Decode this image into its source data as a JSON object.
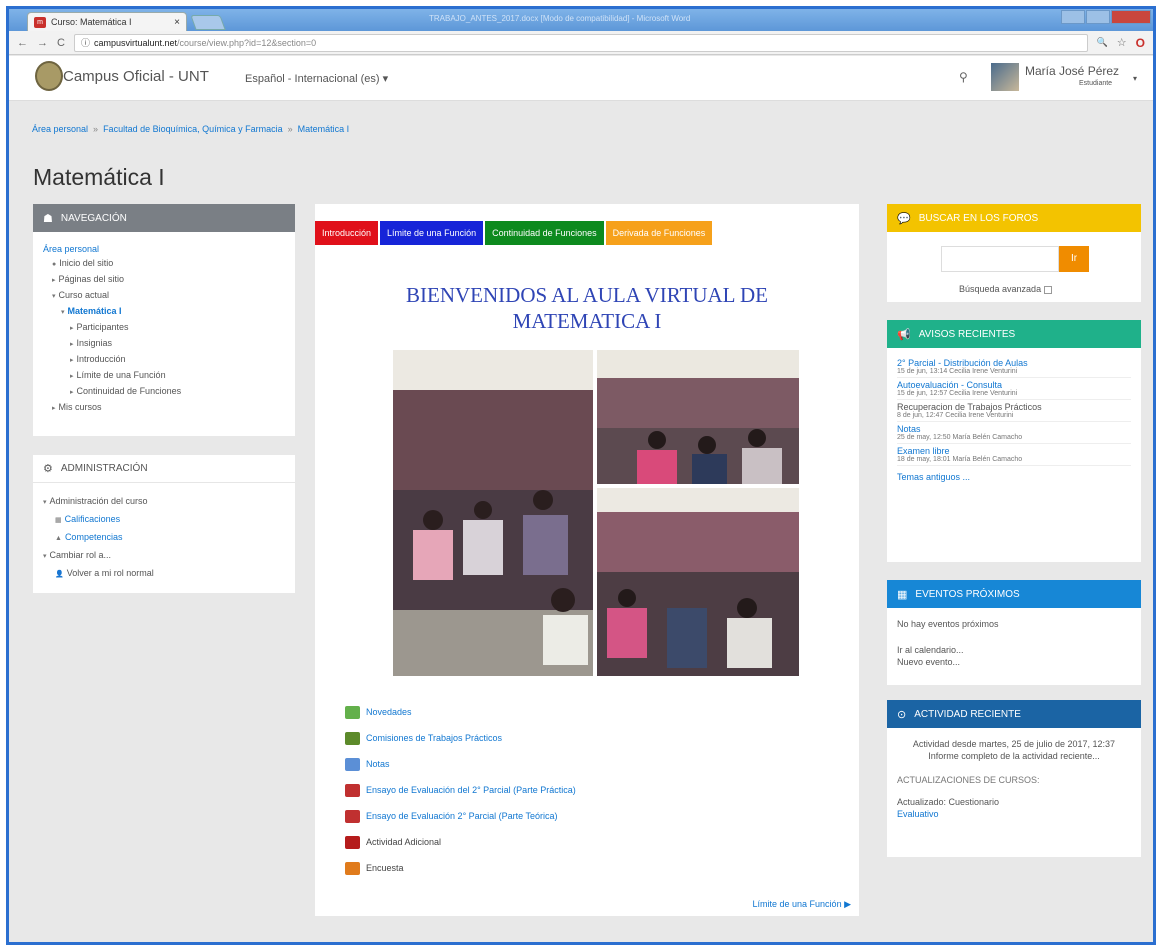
{
  "browser": {
    "tab_title": "Curso: Matemática I",
    "tab_close": "×",
    "window_title": "TRABAJO_ANTES_2017.docx [Modo de compatibilidad] - Microsoft Word",
    "url_host": "campusvirtualunt.net",
    "url_path": "/course/view.php?id=12&section=0",
    "back": "←",
    "forward": "→",
    "reload": "C",
    "info": "ⓘ",
    "zoom_icon": "🔍",
    "star_icon": "☆",
    "opera_icon": "O"
  },
  "navbar": {
    "brand": "Campus Oficial - UNT",
    "language": "Español - Internacional (es) ▾",
    "search_icon": "⚲",
    "user_name": "María José Pérez",
    "user_role": "Estudiante",
    "caret": "▾"
  },
  "breadcrumb": [
    "Área personal",
    "Facultad de Bioquímica, Química y Farmacia",
    "Matemática I"
  ],
  "breadcrumb_sep": "»",
  "page_title": "Matemática I",
  "navigation": {
    "heading": "NAVEGACIÓN",
    "icon": "sitemap-icon",
    "items": [
      {
        "label": "Área personal",
        "marker": "",
        "indent": 0
      },
      {
        "label": "Inicio del sitio",
        "marker": "●",
        "indent": 1
      },
      {
        "label": "Páginas del sitio",
        "marker": "▸",
        "indent": 1
      },
      {
        "label": "Curso actual",
        "marker": "▾",
        "indent": 1
      },
      {
        "label": "Matemática I",
        "marker": "▾",
        "indent": 2
      },
      {
        "label": "Participantes",
        "marker": "▸",
        "indent": 3
      },
      {
        "label": "Insignias",
        "marker": "▸",
        "indent": 3
      },
      {
        "label": "Introducción",
        "marker": "▸",
        "indent": 3
      },
      {
        "label": "Límite de una Función",
        "marker": "▸",
        "indent": 3
      },
      {
        "label": "Continuidad de Funciones",
        "marker": "▸",
        "indent": 3
      },
      {
        "label": "Mis cursos",
        "marker": "▸",
        "indent": 1
      }
    ]
  },
  "administration": {
    "heading": "ADMINISTRACIÓN",
    "items": [
      {
        "label": "Administración del curso",
        "marker": "▾",
        "indent": 0
      },
      {
        "label": "Calificaciones",
        "marker": "▦",
        "indent": 1
      },
      {
        "label": "Competencias",
        "marker": "▲",
        "indent": 1
      },
      {
        "label": "Cambiar rol a...",
        "marker": "▾",
        "indent": 0
      },
      {
        "label": "Volver a mi rol normal",
        "marker": "👤",
        "indent": 1
      }
    ]
  },
  "course_tabs": [
    {
      "label": "Introducción",
      "color": "#e0101a"
    },
    {
      "label": "Límite de una Función",
      "color": "#1624d8"
    },
    {
      "label": "Continuidad de Funciones",
      "color": "#0d8a1e"
    },
    {
      "label": "Derivada de Funciones",
      "color": "#f6a11b"
    }
  ],
  "welcome": {
    "line1": "BIENVENIDOS AL AULA VIRTUAL DE",
    "line2": "MATEMATICA I"
  },
  "resources": [
    {
      "label": "Novedades",
      "icon": "forum-icon",
      "color": "#63b04b"
    },
    {
      "label": "Comisiones de Trabajos Prácticos",
      "icon": "choice-icon",
      "color": "#5c8a2a"
    },
    {
      "label": "Notas",
      "icon": "folder-icon",
      "color": "#5b8fd6"
    },
    {
      "label": "Ensayo de Evaluación del 2° Parcial (Parte Práctica)",
      "icon": "quiz-icon",
      "color": "#c03030"
    },
    {
      "label": "Ensayo de Evaluación 2° Parcial (Parte Teórica)",
      "icon": "quiz-icon",
      "color": "#c03030"
    },
    {
      "label": "Actividad Adicional",
      "icon": "assignment-icon",
      "color": "#b51c1c"
    },
    {
      "label": "Encuesta",
      "icon": "feedback-icon",
      "color": "#e07b1c"
    }
  ],
  "next_section": "Límite de una Función ▶",
  "search_forums": {
    "heading": "BUSCAR EN LOS FOROS",
    "button": "Ir",
    "advanced": "Búsqueda avanzada"
  },
  "news": {
    "heading": "AVISOS RECIENTES",
    "items": [
      {
        "title": "2° Parcial - Distribución de Aulas",
        "meta": "15 de jun, 13:14  Cecilia Irene Venturini"
      },
      {
        "title": "Autoevaluación - Consulta",
        "meta": "15 de jun, 12:57  Cecilia Irene Venturini"
      },
      {
        "title": "Recuperacion de Trabajos Prácticos",
        "meta": "8 de jun, 12:47  Cecilia Irene Venturini"
      },
      {
        "title": "Notas",
        "meta": "25 de may, 12:50  María Belén Camacho"
      },
      {
        "title": "Examen libre",
        "meta": "18 de may, 18:01  María Belén Camacho"
      }
    ],
    "older": "Temas antiguos ..."
  },
  "events": {
    "heading": "EVENTOS PRÓXIMOS",
    "empty": "No hay eventos próximos",
    "calendar": "Ir al calendario...",
    "new_event": "Nuevo evento..."
  },
  "activity": {
    "heading": "ACTIVIDAD RECIENTE",
    "since": "Actividad desde martes, 25 de julio de 2017, 12:37",
    "full_report": "Informe completo de la actividad reciente...",
    "updates_heading": "ACTUALIZACIONES DE CURSOS:",
    "updated": "Actualizado: Cuestionario",
    "updated_link": "Evaluativo"
  }
}
